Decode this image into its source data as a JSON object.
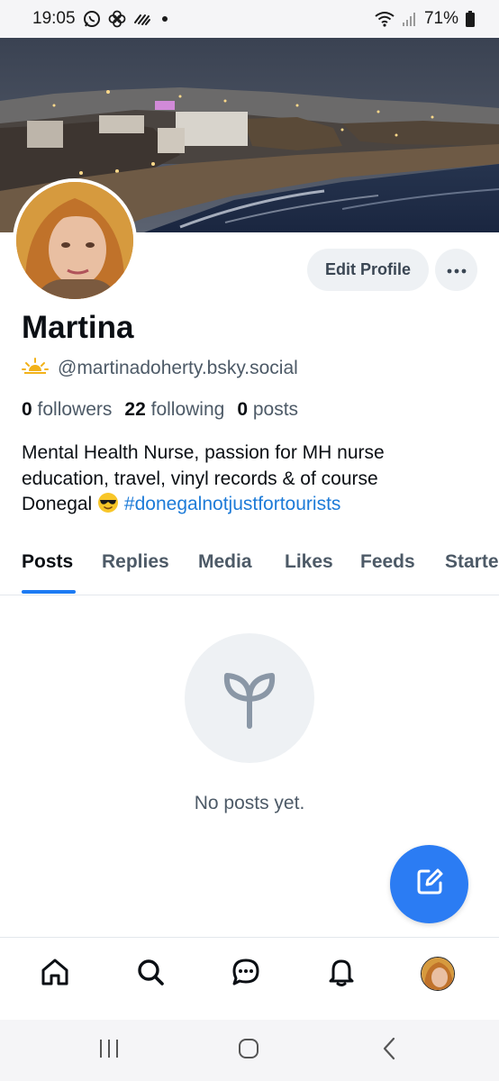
{
  "status_bar": {
    "time": "19:05",
    "battery": "71%",
    "icons": [
      "whatsapp-icon",
      "pinwheel-icon",
      "signal-lines-icon",
      "dot-icon",
      "wifi-icon",
      "cell-signal-icon",
      "battery-icon"
    ]
  },
  "profile": {
    "display_name": "Martina",
    "handle": "@martinadoherty.bsky.social",
    "handle_icon": "sunrise-icon",
    "followers_count": "0",
    "followers_label": "followers",
    "following_count": "22",
    "following_label": "following",
    "posts_count": "0",
    "posts_label": "posts",
    "bio_line1": "Mental Health Nurse, passion for MH nurse",
    "bio_line2": "education, travel, vinyl records & of course",
    "bio_line3_text": "Donegal",
    "bio_emoji": "sunglasses-emoji",
    "bio_hashtag": "#donegalnotjustfortourists"
  },
  "actions": {
    "edit_profile": "Edit Profile",
    "more_icon": "ellipsis-icon"
  },
  "tabs": [
    {
      "label": "Posts",
      "active": true
    },
    {
      "label": "Replies",
      "active": false
    },
    {
      "label": "Media",
      "active": false
    },
    {
      "label": "Likes",
      "active": false
    },
    {
      "label": "Feeds",
      "active": false
    },
    {
      "label": "Starte",
      "active": false
    }
  ],
  "empty_state": {
    "icon": "sprout-icon",
    "message": "No posts yet."
  },
  "fab": {
    "icon": "compose-icon"
  },
  "bottom_nav": [
    "home-icon",
    "search-icon",
    "chat-icon",
    "bell-icon",
    "profile-avatar"
  ],
  "system_nav": [
    "recents-icon",
    "home-circle-icon",
    "back-icon"
  ],
  "colors": {
    "accent": "#1d7bf3",
    "fab": "#2b7cf3",
    "link": "#1d7bd8",
    "muted_text": "#4d5a67",
    "button_bg": "#eef1f4"
  }
}
